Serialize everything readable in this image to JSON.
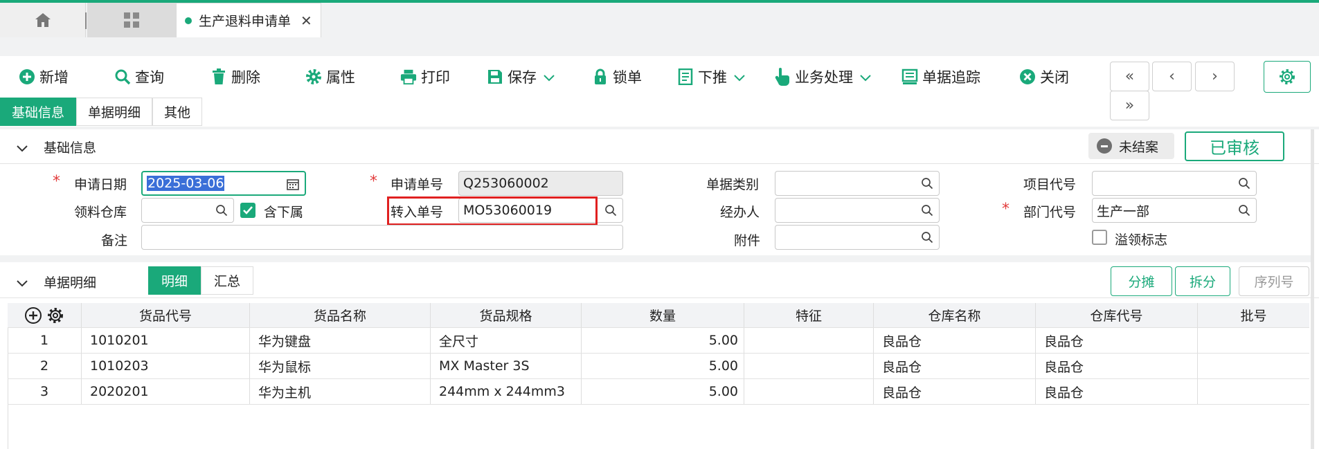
{
  "tabs": {
    "active_title": "生产退料申请单"
  },
  "toolbar": {
    "add": "新增",
    "query": "查询",
    "delete": "删除",
    "properties": "属性",
    "print": "打印",
    "save": "保存",
    "lock": "锁单",
    "push_down": "下推",
    "business": "业务处理",
    "trace": "单据追踪",
    "close": "关闭"
  },
  "section_tabs": [
    "基础信息",
    "单据明细",
    "其他"
  ],
  "basic": {
    "title": "基础信息",
    "status_badge": "未结案",
    "approval_stamp": "已审核",
    "fields": {
      "apply_date_label": "申请日期",
      "apply_date": "2025-03-06",
      "apply_no_label": "申请单号",
      "apply_no": "Q253060002",
      "doc_type_label": "单据类别",
      "doc_type": "",
      "project_code_label": "项目代号",
      "project_code": "",
      "warehouse_label": "领料仓库",
      "warehouse": "",
      "include_sub_label": "含下属",
      "include_sub": true,
      "transfer_no_label": "转入单号",
      "transfer_no": "MO53060019",
      "handler_label": "经办人",
      "handler": "",
      "dept_code_label": "部门代号",
      "dept_code": "生产一部",
      "remark_label": "备注",
      "remark": "",
      "attachment_label": "附件",
      "attachment": "",
      "over_issue_label": "溢领标志",
      "over_issue": false
    }
  },
  "detail": {
    "title": "单据明细",
    "view_toggle": [
      "明细",
      "汇总"
    ],
    "buttons": {
      "allocate": "分摊",
      "split": "拆分",
      "serial": "序列号"
    },
    "columns": [
      "货品代号",
      "货品名称",
      "货品规格",
      "数量",
      "特征",
      "仓库名称",
      "仓库代号",
      "批号"
    ],
    "rows": [
      {
        "no": "1",
        "code": "1010201",
        "name": "华为键盘",
        "spec": "全尺寸",
        "qty": "5.00",
        "feature": "",
        "wh_name": "良品仓",
        "wh_code": "良品仓",
        "batch": ""
      },
      {
        "no": "2",
        "code": "1010203",
        "name": "华为鼠标",
        "spec": "MX Master 3S",
        "qty": "5.00",
        "feature": "",
        "wh_name": "良品仓",
        "wh_code": "良品仓",
        "batch": ""
      },
      {
        "no": "3",
        "code": "2020201",
        "name": "华为主机",
        "spec": "244mm x 244mm3",
        "qty": "5.00",
        "feature": "",
        "wh_name": "良品仓",
        "wh_code": "良品仓",
        "batch": ""
      }
    ]
  },
  "colors": {
    "accent": "#1aa97a",
    "required": "#e23b3b",
    "highlight": "#e02020"
  }
}
